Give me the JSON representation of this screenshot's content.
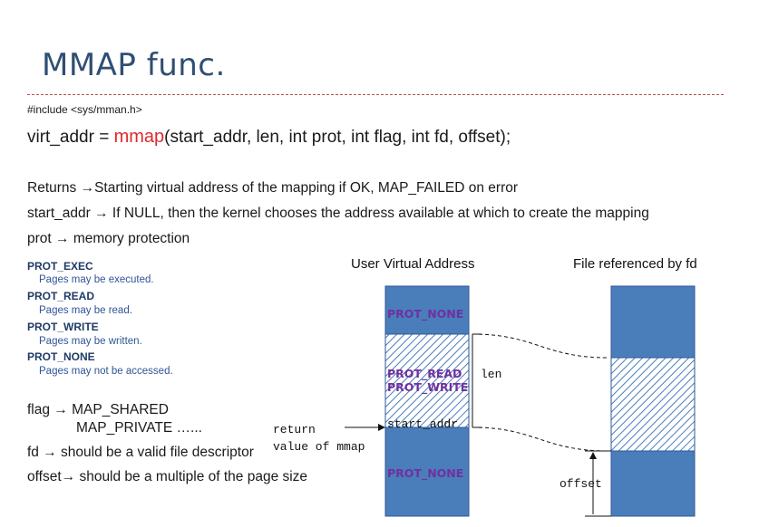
{
  "slide": {
    "title": "MMAP func.",
    "include": "#include <sys/mman.h>",
    "signature": {
      "prefix": "virt_addr = ",
      "function": "mmap",
      "args": "(start_addr, len, int prot, int flag, int fd, offset);"
    },
    "returns": {
      "label": "Returns ",
      "arrow": "→",
      "text": "Starting virtual address of the mapping if OK, MAP_FAILED on error"
    },
    "start_addr": {
      "label": "start_addr ",
      "arrow": "→",
      "text": "  If NULL, then the kernel chooses the address available at which to create the mapping"
    },
    "prot": {
      "label": "prot  ",
      "arrow": "→",
      "text": " memory protection"
    },
    "prot_list": [
      {
        "name": "PROT_EXEC",
        "desc": "Pages may be executed."
      },
      {
        "name": "PROT_READ",
        "desc": "Pages may be read."
      },
      {
        "name": "PROT_WRITE",
        "desc": "Pages may be written."
      },
      {
        "name": "PROT_NONE",
        "desc": "Pages may not be accessed."
      }
    ],
    "flag": {
      "label": "flag ",
      "arrow": "→",
      "text": " MAP_SHARED",
      "second": "MAP_PRIVATE …..."
    },
    "fd": {
      "label": "fd ",
      "arrow": "→",
      "text": " should be a valid file descriptor"
    },
    "offset": {
      "label": "offset",
      "arrow": "→",
      "text": " should be a multiple of the page size"
    }
  },
  "diagram": {
    "user_heading": "User Virtual Address",
    "file_heading": "File referenced by fd",
    "blocks": {
      "top_label": "PROT_NONE",
      "mid_label_1": "PROT_READ",
      "mid_label_2": "PROT_WRITE",
      "bottom_label": "PROT_NONE"
    },
    "len_label": "len",
    "start_addr_label": "start_addr",
    "return_label_1": "return",
    "return_label_2": "value of mmap",
    "offset_label": "offset",
    "colors": {
      "block_blue": "#4a7ebb",
      "block_border": "#2f5597",
      "label_purple": "#7030a0",
      "title_blue": "#2f4f73",
      "accent_red": "#e0282c"
    }
  }
}
